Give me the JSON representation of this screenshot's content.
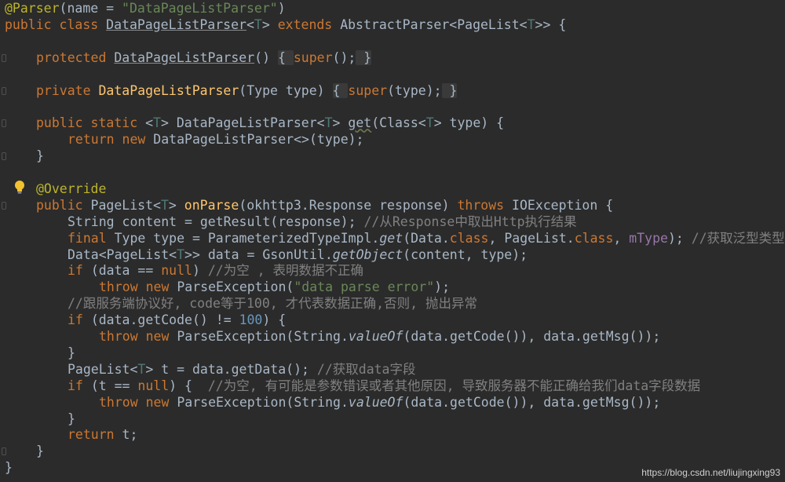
{
  "watermark": "https://blog.csdn.net/liujingxing93",
  "colors": {
    "background": "#2b2b2b",
    "default": "#a9b7c6",
    "keyword": "#cc7832",
    "annotation": "#bbb529",
    "string": "#6a8759",
    "number": "#6897bb",
    "comment": "#808080",
    "method": "#ffc66d",
    "type_param": "#507874",
    "field": "#9876aa"
  },
  "icons": {
    "intention": "lightbulb-icon",
    "fold": "fold-marker-icon"
  },
  "lines": [
    {
      "indent": 0,
      "fold": false,
      "tokens": [
        {
          "t": "@Parser",
          "c": "ann"
        },
        {
          "t": "(name = "
        },
        {
          "t": "\"DataPageListParser\"",
          "c": "str"
        },
        {
          "t": ")"
        }
      ]
    },
    {
      "indent": 0,
      "fold": false,
      "tokens": [
        {
          "t": "public class ",
          "c": "kw"
        },
        {
          "t": "DataPageListParser",
          "c": "un"
        },
        {
          "t": "<"
        },
        {
          "t": "T",
          "c": "tp"
        },
        {
          "t": "> "
        },
        {
          "t": "extends ",
          "c": "kw"
        },
        {
          "t": "AbstractParser<PageList<"
        },
        {
          "t": "T",
          "c": "tp"
        },
        {
          "t": ">> {"
        }
      ]
    },
    {
      "indent": 0,
      "fold": false,
      "tokens": []
    },
    {
      "indent": 1,
      "fold": true,
      "tokens": [
        {
          "t": "protected ",
          "c": "kw"
        },
        {
          "t": "DataPageListParser",
          "c": "un"
        },
        {
          "t": "() "
        },
        {
          "t": "{ ",
          "c": "gf"
        },
        {
          "t": "super",
          "c": "kw"
        },
        {
          "t": "();"
        },
        {
          "t": " }",
          "c": "gf"
        }
      ]
    },
    {
      "indent": 0,
      "fold": false,
      "tokens": []
    },
    {
      "indent": 1,
      "fold": true,
      "tokens": [
        {
          "t": "private ",
          "c": "kw"
        },
        {
          "t": "DataPageListParser",
          "c": "fn"
        },
        {
          "t": "(Type type) "
        },
        {
          "t": "{ ",
          "c": "gf"
        },
        {
          "t": "super",
          "c": "kw"
        },
        {
          "t": "(type);"
        },
        {
          "t": " }",
          "c": "gf"
        }
      ]
    },
    {
      "indent": 0,
      "fold": false,
      "tokens": []
    },
    {
      "indent": 1,
      "fold": true,
      "tokens": [
        {
          "t": "public static ",
          "c": "kw"
        },
        {
          "t": "<"
        },
        {
          "t": "T",
          "c": "tp"
        },
        {
          "t": "> DataPageListParser<"
        },
        {
          "t": "T",
          "c": "tp"
        },
        {
          "t": "> "
        },
        {
          "t": "get",
          "c": "wv"
        },
        {
          "t": "(Class<"
        },
        {
          "t": "T",
          "c": "tp"
        },
        {
          "t": "> type) {"
        }
      ]
    },
    {
      "indent": 2,
      "fold": false,
      "tokens": [
        {
          "t": "return new ",
          "c": "kw"
        },
        {
          "t": "DataPageListParser<>(type);"
        }
      ]
    },
    {
      "indent": 1,
      "fold": true,
      "tokens": [
        {
          "t": "}"
        }
      ]
    },
    {
      "indent": 0,
      "fold": false,
      "tokens": []
    },
    {
      "indent": 1,
      "fold": false,
      "tokens": [
        {
          "t": "@Override",
          "c": "ann"
        }
      ]
    },
    {
      "indent": 1,
      "fold": true,
      "tokens": [
        {
          "t": "public ",
          "c": "kw"
        },
        {
          "t": "PageList<"
        },
        {
          "t": "T",
          "c": "tp"
        },
        {
          "t": "> "
        },
        {
          "t": "onParse",
          "c": "fn"
        },
        {
          "t": "(okhttp3.Response response) "
        },
        {
          "t": "throws ",
          "c": "kw"
        },
        {
          "t": "IOException {"
        }
      ]
    },
    {
      "indent": 2,
      "fold": false,
      "tokens": [
        {
          "t": "String content = getResult(response); "
        },
        {
          "t": "//从Response中取出Http执行结果",
          "c": "com"
        }
      ]
    },
    {
      "indent": 2,
      "fold": false,
      "tokens": [
        {
          "t": "final ",
          "c": "kw"
        },
        {
          "t": "Type type = ParameterizedTypeImpl."
        },
        {
          "t": "get",
          "c": "it"
        },
        {
          "t": "(Data."
        },
        {
          "t": "class",
          "c": "kw"
        },
        {
          "t": ", PageList."
        },
        {
          "t": "class",
          "c": "kw"
        },
        {
          "t": ", "
        },
        {
          "t": "mType",
          "c": "fld"
        },
        {
          "t": "); "
        },
        {
          "t": "//获取泛型类型",
          "c": "com"
        }
      ]
    },
    {
      "indent": 2,
      "fold": false,
      "tokens": [
        {
          "t": "Data<PageList<"
        },
        {
          "t": "T",
          "c": "tp"
        },
        {
          "t": ">> data = GsonUtil."
        },
        {
          "t": "getObject",
          "c": "it"
        },
        {
          "t": "(content, type);"
        }
      ]
    },
    {
      "indent": 2,
      "fold": false,
      "tokens": [
        {
          "t": "if ",
          "c": "kw"
        },
        {
          "t": "(data == "
        },
        {
          "t": "null",
          "c": "kw"
        },
        {
          "t": ") "
        },
        {
          "t": "//为空 , 表明数据不正确",
          "c": "com"
        }
      ]
    },
    {
      "indent": 3,
      "fold": false,
      "tokens": [
        {
          "t": "throw new ",
          "c": "kw"
        },
        {
          "t": "ParseException("
        },
        {
          "t": "\"data parse error\"",
          "c": "str"
        },
        {
          "t": ");"
        }
      ]
    },
    {
      "indent": 2,
      "fold": false,
      "tokens": [
        {
          "t": "//跟服务端协议好, code等于100, 才代表数据正确,否则, 抛出异常",
          "c": "com"
        }
      ]
    },
    {
      "indent": 2,
      "fold": false,
      "tokens": [
        {
          "t": "if ",
          "c": "kw"
        },
        {
          "t": "(data.getCode() != "
        },
        {
          "t": "100",
          "c": "num"
        },
        {
          "t": ") {"
        }
      ]
    },
    {
      "indent": 3,
      "fold": false,
      "tokens": [
        {
          "t": "throw new ",
          "c": "kw"
        },
        {
          "t": "ParseException(String."
        },
        {
          "t": "valueOf",
          "c": "it"
        },
        {
          "t": "(data.getCode()), data.getMsg());"
        }
      ]
    },
    {
      "indent": 2,
      "fold": false,
      "tokens": [
        {
          "t": "}"
        }
      ]
    },
    {
      "indent": 2,
      "fold": false,
      "tokens": [
        {
          "t": "PageList<"
        },
        {
          "t": "T",
          "c": "tp"
        },
        {
          "t": "> t = data.getData(); "
        },
        {
          "t": "//获取data字段",
          "c": "com"
        }
      ]
    },
    {
      "indent": 2,
      "fold": false,
      "tokens": [
        {
          "t": "if ",
          "c": "kw"
        },
        {
          "t": "(t == "
        },
        {
          "t": "null",
          "c": "kw"
        },
        {
          "t": ") {  "
        },
        {
          "t": "//为空, 有可能是参数错误或者其他原因, 导致服务器不能正确给我们data字段数据",
          "c": "com"
        }
      ]
    },
    {
      "indent": 3,
      "fold": false,
      "tokens": [
        {
          "t": "throw new ",
          "c": "kw"
        },
        {
          "t": "ParseException(String."
        },
        {
          "t": "valueOf",
          "c": "it"
        },
        {
          "t": "(data.getCode()), data.getMsg());"
        }
      ]
    },
    {
      "indent": 2,
      "fold": false,
      "tokens": [
        {
          "t": "}"
        }
      ]
    },
    {
      "indent": 2,
      "fold": false,
      "tokens": [
        {
          "t": "return ",
          "c": "kw"
        },
        {
          "t": "t;"
        }
      ]
    },
    {
      "indent": 1,
      "fold": true,
      "tokens": [
        {
          "t": "}"
        }
      ]
    },
    {
      "indent": 0,
      "fold": false,
      "tokens": [
        {
          "t": "}"
        }
      ]
    }
  ]
}
